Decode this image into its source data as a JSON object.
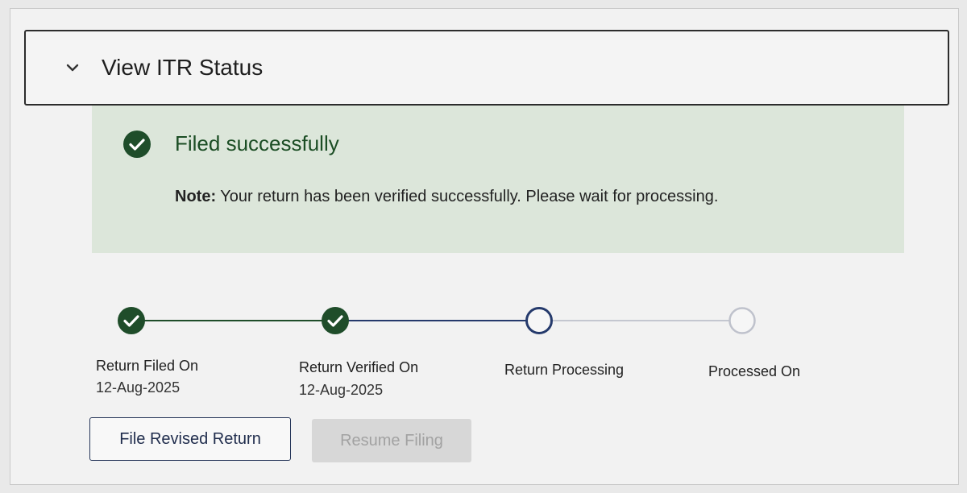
{
  "header": {
    "title": "View ITR Status",
    "chevron_icon": "chevron-down-icon"
  },
  "banner": {
    "icon": "check-circle-icon",
    "title": "Filed successfully",
    "note_label": "Note:",
    "note_text": " Your return has been verified successfully. Please wait for processing.",
    "background": "#dce6da",
    "accent": "#1f4d2a"
  },
  "steps": [
    {
      "label": "Return Filed On",
      "date": "12-Aug-2025",
      "status": "completed"
    },
    {
      "label": "Return Verified On",
      "date": "12-Aug-2025",
      "status": "completed"
    },
    {
      "label": "Return Processing",
      "date": "",
      "status": "current"
    },
    {
      "label": "Processed On",
      "date": "",
      "status": "pending"
    }
  ],
  "colors": {
    "completed": "#1f4d2a",
    "current": "#253a6c",
    "pending": "#bfc2cc"
  },
  "actions": {
    "file_revised_return": "File Revised Return",
    "resume_filing": "Resume Filing"
  }
}
